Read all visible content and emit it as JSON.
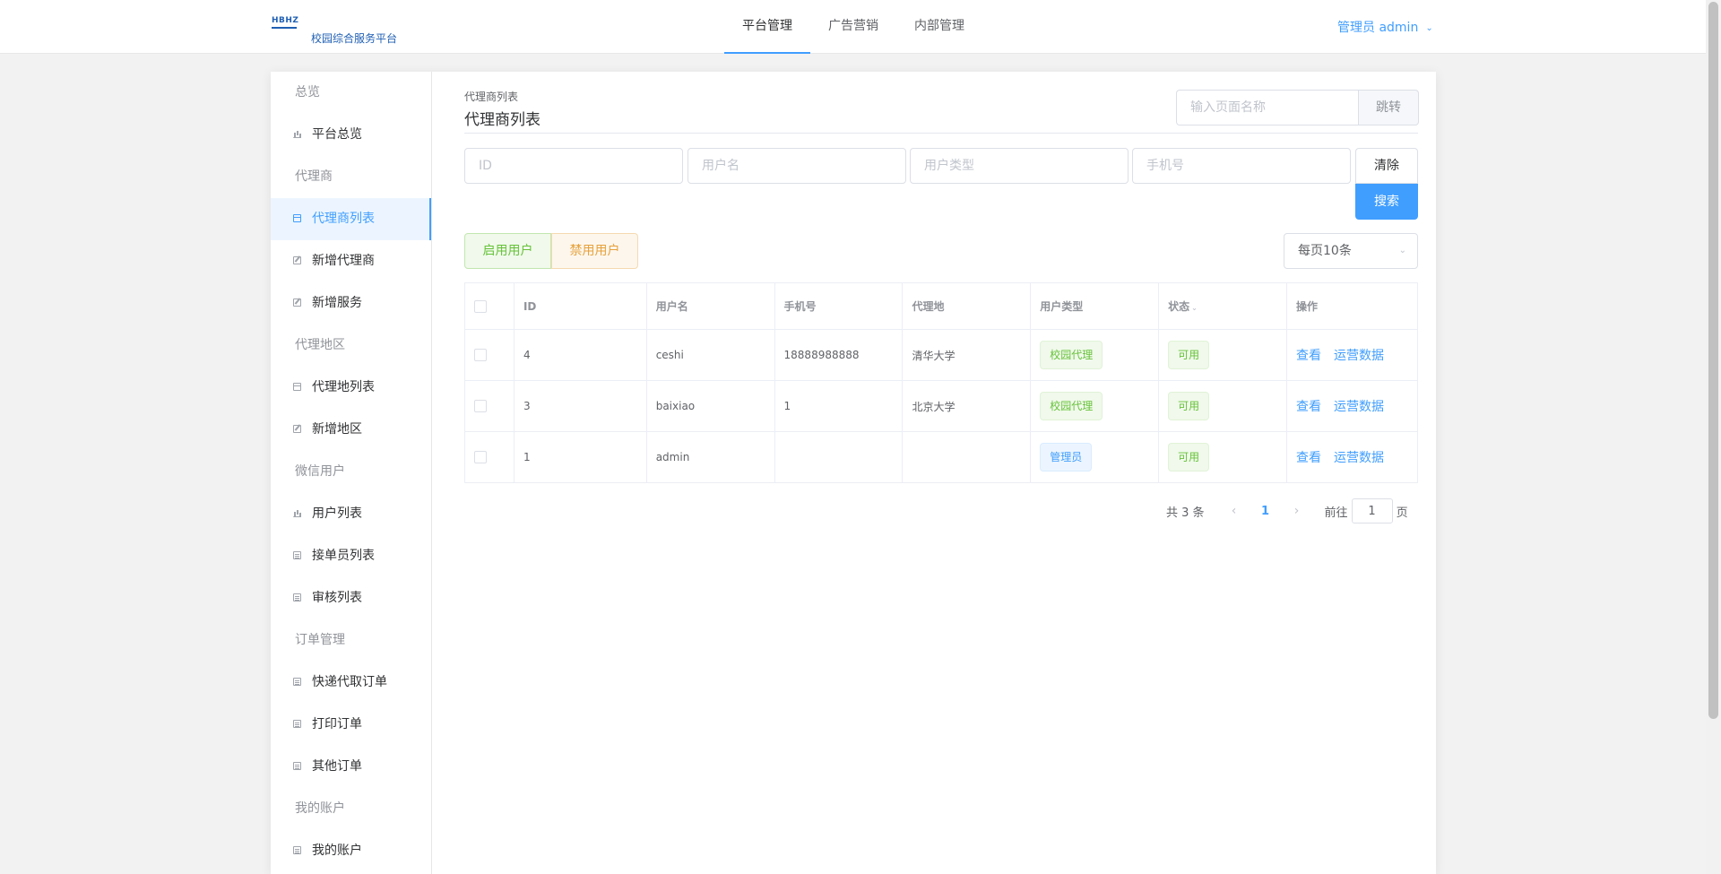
{
  "header": {
    "logo_mark": "HBHZ",
    "logo_text": "校园综合服务平台",
    "nav": [
      {
        "label": "平台管理",
        "active": true
      },
      {
        "label": "广告营销",
        "active": false
      },
      {
        "label": "内部管理",
        "active": false
      }
    ],
    "user": "管理员 admin"
  },
  "sidebar": {
    "groups": [
      {
        "label": "总览",
        "items": [
          {
            "label": "平台总览",
            "icon": "bar-chart-icon"
          }
        ]
      },
      {
        "label": "代理商",
        "items": [
          {
            "label": "代理商列表",
            "icon": "calendar-icon",
            "active": true
          },
          {
            "label": "新增代理商",
            "icon": "edit-icon"
          },
          {
            "label": "新增服务",
            "icon": "edit-icon"
          }
        ]
      },
      {
        "label": "代理地区",
        "items": [
          {
            "label": "代理地列表",
            "icon": "calendar-icon"
          },
          {
            "label": "新增地区",
            "icon": "edit-icon"
          }
        ]
      },
      {
        "label": "微信用户",
        "items": [
          {
            "label": "用户列表",
            "icon": "bar-chart-icon"
          },
          {
            "label": "接单员列表",
            "icon": "document-icon"
          },
          {
            "label": "审核列表",
            "icon": "document-icon"
          }
        ]
      },
      {
        "label": "订单管理",
        "items": [
          {
            "label": "快递代取订单",
            "icon": "document-icon"
          },
          {
            "label": "打印订单",
            "icon": "document-icon"
          },
          {
            "label": "其他订单",
            "icon": "document-icon"
          }
        ]
      },
      {
        "label": "我的账户",
        "items": [
          {
            "label": "我的账户",
            "icon": "document-icon"
          }
        ]
      }
    ]
  },
  "page": {
    "breadcrumb": "代理商列表",
    "title": "代理商列表",
    "jump_placeholder": "输入页面名称",
    "jump_label": "跳转"
  },
  "filters": {
    "id_placeholder": "ID",
    "username_placeholder": "用户名",
    "usertype_placeholder": "用户类型",
    "phone_placeholder": "手机号",
    "clear_label": "清除",
    "search_label": "搜索"
  },
  "actions": {
    "enable_label": "启用用户",
    "disable_label": "禁用用户",
    "page_size": "每页10条"
  },
  "table": {
    "columns": [
      "ID",
      "用户名",
      "手机号",
      "代理地",
      "用户类型",
      "状态",
      "操作"
    ],
    "sort_caret": "⌄",
    "rows": [
      {
        "id": "4",
        "username": "ceshi",
        "phone": "18888988888",
        "area": "清华大学",
        "type": "校园代理",
        "type_color": "green",
        "status": "可用",
        "view": "查看",
        "ops": "运营数据"
      },
      {
        "id": "3",
        "username": "baixiao",
        "phone": "1",
        "area": "北京大学",
        "type": "校园代理",
        "type_color": "green",
        "status": "可用",
        "view": "查看",
        "ops": "运营数据"
      },
      {
        "id": "1",
        "username": "admin",
        "phone": "",
        "area": "",
        "type": "管理员",
        "type_color": "blue",
        "status": "可用",
        "view": "查看",
        "ops": "运营数据"
      }
    ]
  },
  "pagination": {
    "total": "共 3 条",
    "current": "1",
    "goto_label": "前往",
    "goto_value": "1",
    "page_suffix": "页"
  },
  "colors": {
    "primary": "#409eff",
    "success": "#67c23a",
    "warning": "#e6a23c"
  }
}
